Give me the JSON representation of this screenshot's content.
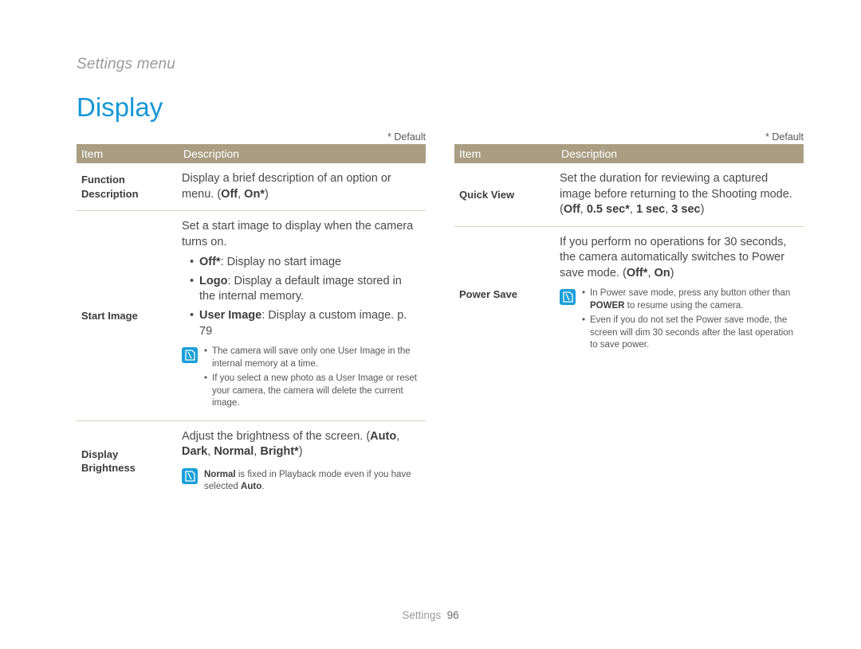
{
  "breadcrumb": "Settings menu",
  "section_title": "Display",
  "default_note": "* Default",
  "headers": {
    "item": "Item",
    "description": "Description"
  },
  "bold": {
    "off": "Off",
    "on": "On",
    "on_star": "On*",
    "off_star": "Off*",
    "logo": "Logo",
    "user_image": "User Image",
    "auto": "Auto",
    "dark": "Dark",
    "normal": "Normal",
    "bright_star": "Bright*",
    "05sec_star": "0.5 sec*",
    "1sec": "1 sec",
    "3sec": "3 sec",
    "power": "POWER"
  },
  "left": {
    "rows": [
      {
        "item": "Function Description",
        "desc_prefix": "Display a brief description of an option or menu. ("
      },
      {
        "item": "Start Image",
        "intro": "Set a start image to display when the camera turns on.",
        "bul_off_tail": ": Display no start image",
        "bul_logo_tail": ": Display a default image stored in the internal memory.",
        "bul_user_tail": ": Display a custom image. p. 79",
        "note1": "The camera will save only one User Image in the internal memory at a time.",
        "note2": "If you select a new photo as a User Image or reset your camera, the camera will delete the current image."
      },
      {
        "item": "Display Brightness",
        "desc_prefix": "Adjust the brightness of the screen. (",
        "note_prefix_bold": "Normal",
        "note_tail1": " is fixed in Playback mode even if you have selected ",
        "note_tail_bold": "Auto",
        "note_tail2": "."
      }
    ]
  },
  "right": {
    "rows": [
      {
        "item": "Quick View",
        "desc_prefix": "Set the duration for reviewing a captured image before returning to the Shooting mode. ("
      },
      {
        "item": "Power Save",
        "desc_prefix": "If you perform no operations for 30 seconds, the camera automatically switches to Power save mode. (",
        "note1_pre": "In Power save mode, press any button other than ",
        "note1_post": " to resume using the camera.",
        "note2": "Even if you do not set the Power save mode, the screen will dim 30 seconds after the last operation to save power."
      }
    ]
  },
  "footer": {
    "label": "Settings",
    "page": "96"
  }
}
